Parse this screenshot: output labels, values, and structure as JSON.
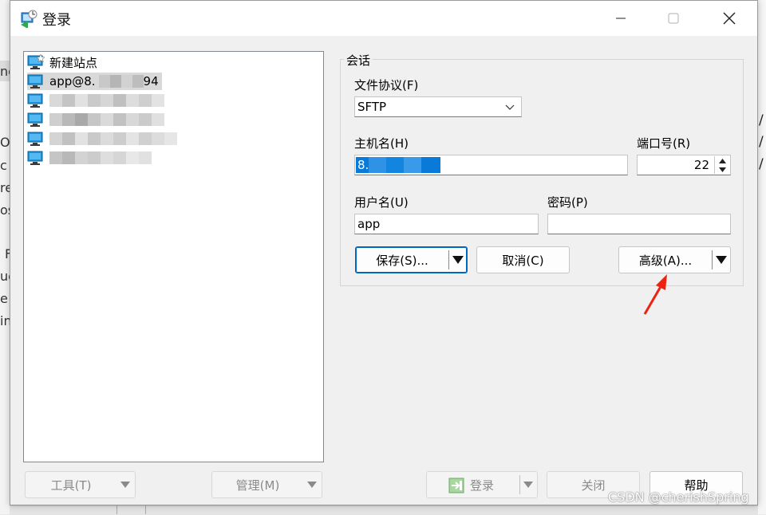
{
  "window": {
    "title": "登录"
  },
  "sites": [
    {
      "label": "新建站点",
      "icon": "new-site-icon",
      "selected": false
    },
    {
      "label_prefix": "app@8.",
      "label_suffix": "94",
      "icon": "computer-icon",
      "selected": true
    },
    {
      "icon": "computer-icon",
      "selected": false
    },
    {
      "icon": "computer-icon",
      "selected": false
    },
    {
      "icon": "computer-icon",
      "selected": false
    },
    {
      "icon": "computer-icon",
      "selected": false
    }
  ],
  "session": {
    "legend": "会话",
    "protocol_label": "文件协议(F)",
    "protocol_value": "SFTP",
    "host_label": "主机名(H)",
    "host_value_prefix": "8.",
    "port_label": "端口号(R)",
    "port_value": "22",
    "user_label": "用户名(U)",
    "user_value": "app",
    "password_label": "密码(P)",
    "password_value": ""
  },
  "buttons": {
    "save": "保存(S)...",
    "cancel": "取消(C)",
    "advanced": "高级(A)...",
    "tools": "工具(T)",
    "manage": "管理(M)",
    "login": "登录",
    "close": "关闭",
    "help": "帮助"
  },
  "watermark": "CSDN @cherishSpring",
  "background_fragments": [
    "ne",
    "O",
    "c",
    "re",
    "os",
    "F",
    "uc",
    "e",
    "in"
  ],
  "colors": {
    "accent": "#0067c0",
    "selection": "#0a7ad8",
    "annotation_arrow": "#ee2211"
  }
}
